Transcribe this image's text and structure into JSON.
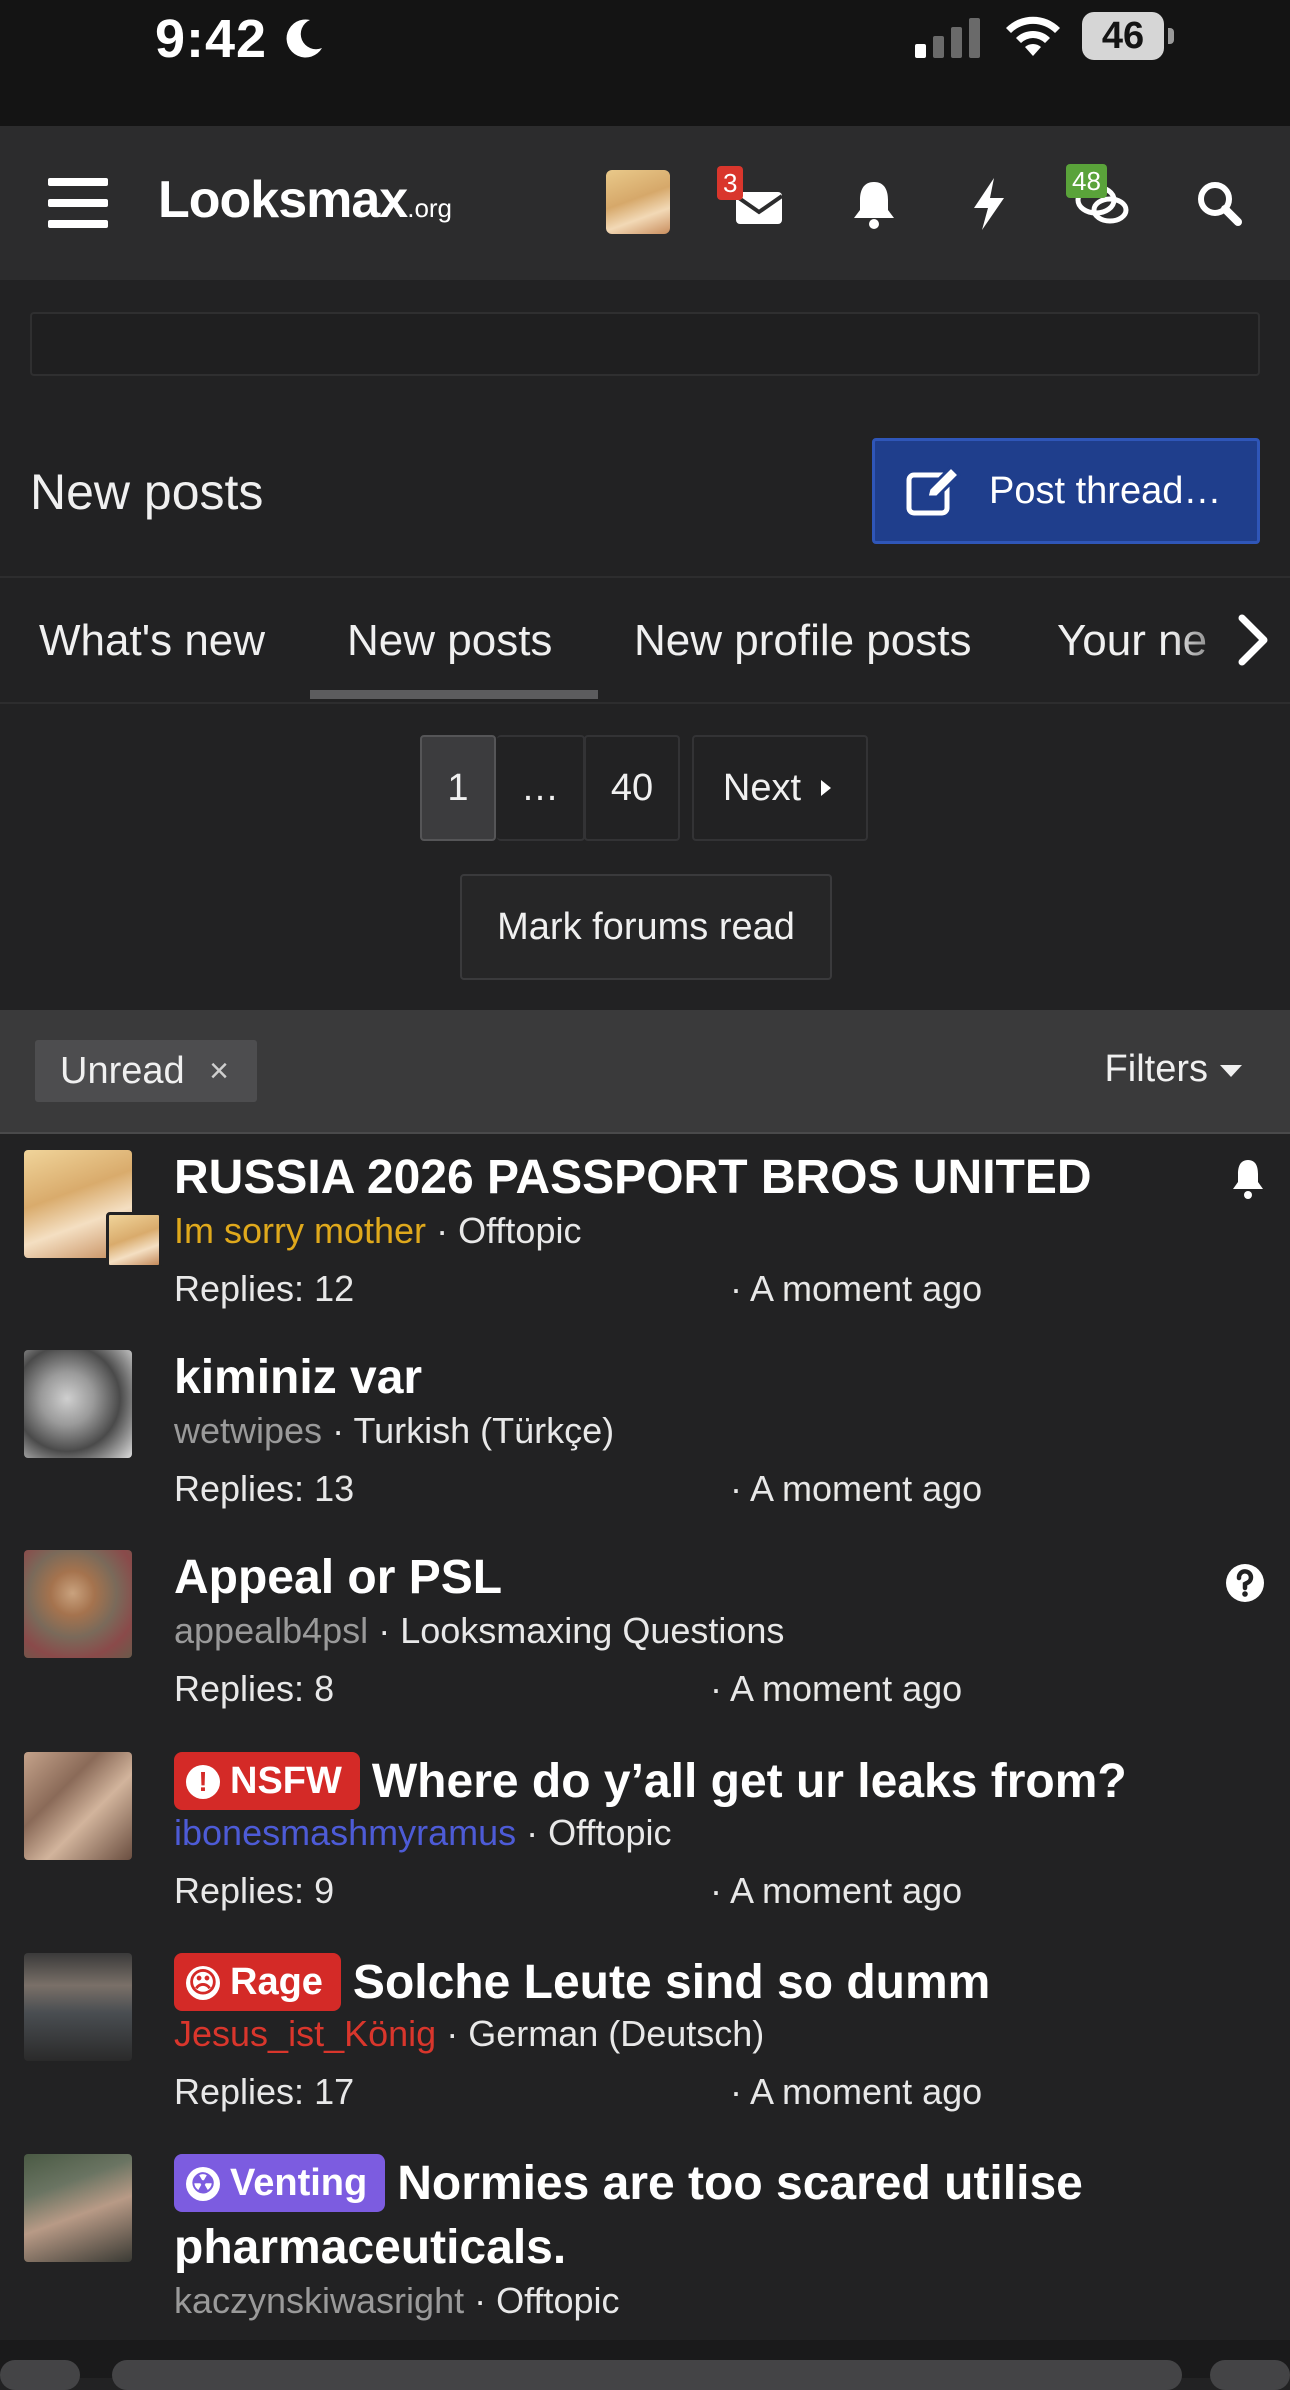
{
  "status_bar": {
    "time": "9:42",
    "battery": "46"
  },
  "header": {
    "logo_main": "Looksmax",
    "logo_suffix": ".org",
    "inbox_badge": "3",
    "chat_badge": "48"
  },
  "page": {
    "title": "New posts",
    "post_thread_label": "Post thread…"
  },
  "tabs": [
    {
      "label": "What's new"
    },
    {
      "label": "New posts"
    },
    {
      "label": "New profile posts"
    },
    {
      "label": "Your ne"
    }
  ],
  "pagination": {
    "current": "1",
    "ellipsis": "…",
    "last": "40",
    "next": "Next"
  },
  "mark_read_label": "Mark forums read",
  "filter_bar": {
    "chip_label": "Unread",
    "chip_close": "×",
    "filters_label": "Filters"
  },
  "threads": [
    {
      "title": "RUSSIA 2026 PASSPORT BROS UNITED",
      "author": "Im sorry mother",
      "forum": "Offtopic",
      "replies": "Replies: 12",
      "time": "A moment ago"
    },
    {
      "title": "kiminiz var",
      "author": "wetwipes",
      "forum": "Turkish (Türkçe)",
      "replies": "Replies: 13",
      "time": "A moment ago"
    },
    {
      "title": "Appeal or PSL",
      "author": "appealb4psl",
      "forum": "Looksmaxing Questions",
      "replies": "Replies: 8",
      "time": "A moment ago"
    },
    {
      "prefix": "NSFW",
      "title": "Where do y’all get ur leaks from?",
      "author": "ibonesmashmyramus",
      "forum": "Offtopic",
      "replies": "Replies: 9",
      "time": "A moment ago"
    },
    {
      "prefix": "Rage",
      "title": "Solche Leute sind so dumm",
      "author": "Jesus_ist_König",
      "forum": "German (Deutsch)",
      "replies": "Replies: 17",
      "time": "A moment ago"
    },
    {
      "prefix": "Venting",
      "title_line1": "Normies are too scared utilise",
      "title_line2": "pharmaceuticals.",
      "author": "kaczynskiwasright",
      "forum": "Offtopic"
    }
  ],
  "separator": "·"
}
